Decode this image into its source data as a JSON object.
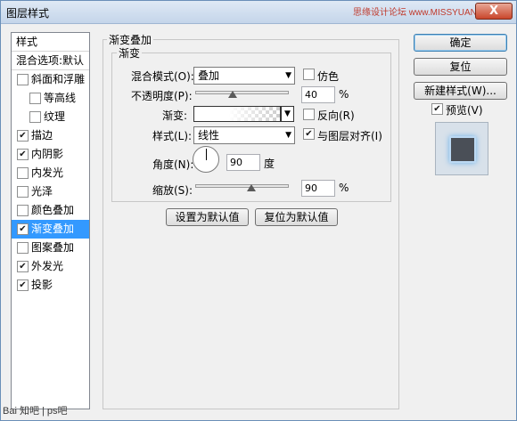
{
  "window": {
    "title": "图层样式",
    "watermark": "思缘设计论坛 www.MISSYUAN.COM",
    "close_label": "X"
  },
  "left_panel": {
    "header": "样式",
    "blend_options": "混合选项:默认",
    "items": [
      {
        "label": "斜面和浮雕",
        "checked": false,
        "indent": false
      },
      {
        "label": "等高线",
        "checked": false,
        "indent": true
      },
      {
        "label": "纹理",
        "checked": false,
        "indent": true
      },
      {
        "label": "描边",
        "checked": true,
        "indent": false
      },
      {
        "label": "内阴影",
        "checked": true,
        "indent": false
      },
      {
        "label": "内发光",
        "checked": false,
        "indent": false
      },
      {
        "label": "光泽",
        "checked": false,
        "indent": false
      },
      {
        "label": "颜色叠加",
        "checked": false,
        "indent": false
      },
      {
        "label": "渐变叠加",
        "checked": true,
        "indent": false,
        "selected": true
      },
      {
        "label": "图案叠加",
        "checked": false,
        "indent": false
      },
      {
        "label": "外发光",
        "checked": true,
        "indent": false
      },
      {
        "label": "投影",
        "checked": true,
        "indent": false
      }
    ]
  },
  "buttons": {
    "ok": "确定",
    "reset": "复位",
    "new_style": "新建样式(W)...",
    "preview_label": "预览(V)",
    "preview_checked": true
  },
  "panel": {
    "title": "渐变叠加",
    "group_title": "渐变",
    "blend_mode_label": "混合模式(O):",
    "blend_mode_value": "叠加",
    "dither_label": "仿色",
    "opacity_label": "不透明度(P):",
    "opacity_value": "40",
    "opacity_unit": "%",
    "opacity_level": 0.4,
    "gradient_label": "渐变:",
    "reverse_label": "反向(R)",
    "style_label": "样式(L):",
    "style_value": "线性",
    "align_label": "与图层对齐(I)",
    "align_checked": true,
    "angle_label": "角度(N):",
    "angle_value": "90",
    "angle_unit": "度",
    "scale_label": "缩放(S):",
    "scale_value": "90",
    "scale_unit": "%",
    "scale_level": 0.6,
    "set_default": "设置为默认值",
    "reset_default": "复位为默认值"
  },
  "footer": {
    "text": "Bai 知吧 | ps吧"
  },
  "colors": {
    "selection": "#3399ff",
    "preview_glow": "#6fb3ea"
  }
}
